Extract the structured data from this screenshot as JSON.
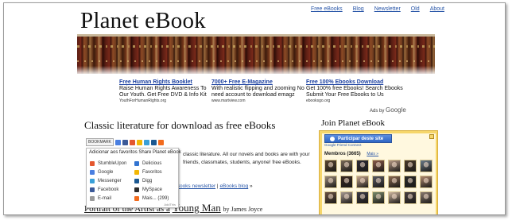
{
  "header": {
    "site_title": "Planet eBook",
    "nav": [
      "Free eBooks",
      "Blog",
      "Newsletter",
      "Old",
      "About"
    ]
  },
  "ads": [
    {
      "title": "Free Human Rights Booklet",
      "text": "Raise Human Rights Awareness To Our Youth. Get Free DVD & Info Kit",
      "url": "YouthForHumanRights.org"
    },
    {
      "title": "7000+ Free E-Magazine",
      "text": "With realistic flipping and zooming No need account to download emagz",
      "url": "www.martview.com"
    },
    {
      "title": "Free 100% Ebooks Download",
      "text": "Get 100% free Ebooks! Search Ebooks Submit Your Free Ebooks to Us",
      "url": "ebooksgo.org"
    }
  ],
  "ads_by": {
    "label": "Ads by",
    "brand": "Google"
  },
  "main": {
    "heading": "Classic literature for download as free eBooks",
    "bookmark_label": "BOOKMARK",
    "body_text": "classic literature. All our novels and books are with your friends, classmates, students, anyone! free eBooks.",
    "links_prefix": "",
    "newsletter_link": "eBooks newsletter",
    "separator": " | ",
    "blog_link": "eBooks blog",
    "links_suffix": "»",
    "article": {
      "title_part1": "Portrait of the Artist as a",
      "title_part2": "Young Man",
      "by": "by James Joyce"
    }
  },
  "share_popup": {
    "header": "Adicionar aos favoritos Share Planet eBook",
    "left_items": [
      {
        "label": "StumbleUpon",
        "icon": "stumbleupon-icon",
        "color": "#e4572e"
      },
      {
        "label": "Google",
        "icon": "google-icon",
        "color": "#4a7fe0"
      },
      {
        "label": "Messenger",
        "icon": "messenger-icon",
        "color": "#3aa0d8"
      },
      {
        "label": "Facebook",
        "icon": "facebook-icon",
        "color": "#3b5998"
      },
      {
        "label": "E-mail",
        "icon": "email-icon",
        "color": "#9a9a9a"
      }
    ],
    "right_items": [
      {
        "label": "Delicious",
        "icon": "delicious-icon",
        "color": "#3274d1"
      },
      {
        "label": "Favoritos",
        "icon": "favorites-icon",
        "color": "#f2b705"
      },
      {
        "label": "Digg",
        "icon": "digg-icon",
        "color": "#1b5891"
      },
      {
        "label": "MySpace",
        "icon": "myspace-icon",
        "color": "#2c2c2c"
      },
      {
        "label": "Mais... (299)",
        "icon": "more-icon",
        "color": "#f26b1d"
      }
    ],
    "footer": "AddThis"
  },
  "sidebar": {
    "heading": "Join Planet eBook",
    "join_button": "Participar deste site",
    "gfc_label": "Google Friend Connect",
    "members_label": "Membros (3665)",
    "see_all": "Mais »",
    "avatar_colors": [
      "#5a4632",
      "#7a6a58",
      "#2c2a36",
      "#8a5a48",
      "#b89a86",
      "#4a3a2a",
      "#6a7a88",
      "#9a8a7a",
      "#3a2a22",
      "#c8a890",
      "#5a5a62",
      "#8a6a52",
      "#2a2a2a",
      "#b08a70",
      "#6a5242",
      "#a89a92",
      "#3a3a46",
      "#7a8a6a",
      "#d0b8a0",
      "#4a4040",
      "#8a7a70"
    ]
  }
}
